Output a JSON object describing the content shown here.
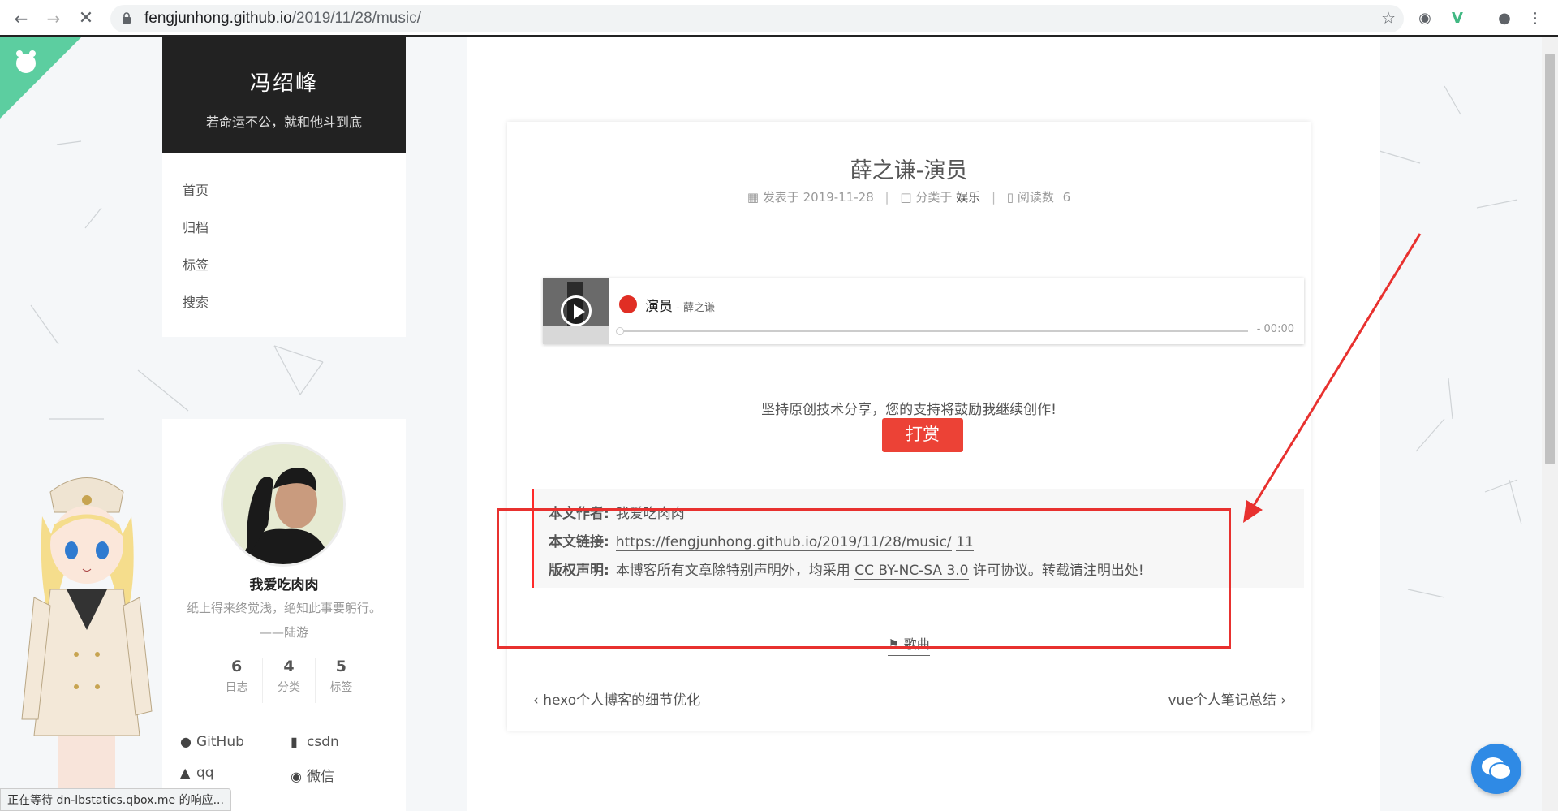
{
  "browser": {
    "url_host": "fengjunhong.github.io",
    "url_path": "/2019/11/28/music/",
    "status_text": "正在等待 dn-lbstatics.qbox.me 的响应..."
  },
  "site": {
    "title": "冯绍峰",
    "subtitle": "若命运不公，就和他斗到底"
  },
  "menu": [
    "首页",
    "归档",
    "标签",
    "搜索"
  ],
  "profile": {
    "name": "我爱吃肉肉",
    "motto": "纸上得来终觉浅，绝知此事要躬行。",
    "motto_source": "——陆游",
    "stats": [
      {
        "num": "6",
        "label": "日志"
      },
      {
        "num": "4",
        "label": "分类"
      },
      {
        "num": "5",
        "label": "标签"
      }
    ],
    "links": [
      "GitHub",
      "csdn",
      "qq",
      "微信"
    ]
  },
  "post": {
    "title": "薛之谦-演员",
    "posted_label": "发表于",
    "date": "2019-11-28",
    "category_label": "分类于",
    "category": "娱乐",
    "views_label": "阅读数",
    "views": "6",
    "player": {
      "song": "演员",
      "artist": " - 薛之谦",
      "time": "- 00:00"
    },
    "reward_text": "坚持原创技术分享，您的支持将鼓励我继续创作!",
    "reward_button": "打赏",
    "copyright": {
      "author_label": "本文作者:",
      "author": "我爱吃肉肉",
      "link_label": "本文链接:",
      "link": "https://fengjunhong.github.io/2019/11/28/music/",
      "link_extra": "11",
      "license_label": "版权声明:",
      "license_pre": "本博客所有文章除特别声明外，均采用",
      "license_name": "CC BY-NC-SA 3.0",
      "license_post": "许可协议。转载请注明出处!"
    },
    "tag": "歌曲",
    "prev": "hexo个人博客的细节优化",
    "next": "vue个人笔记总结"
  },
  "colors": {
    "accent_red": "#ec4236",
    "annotation_red": "#e8312f",
    "chat_blue": "#2f8ae5",
    "corner_green": "#5ccea0"
  }
}
